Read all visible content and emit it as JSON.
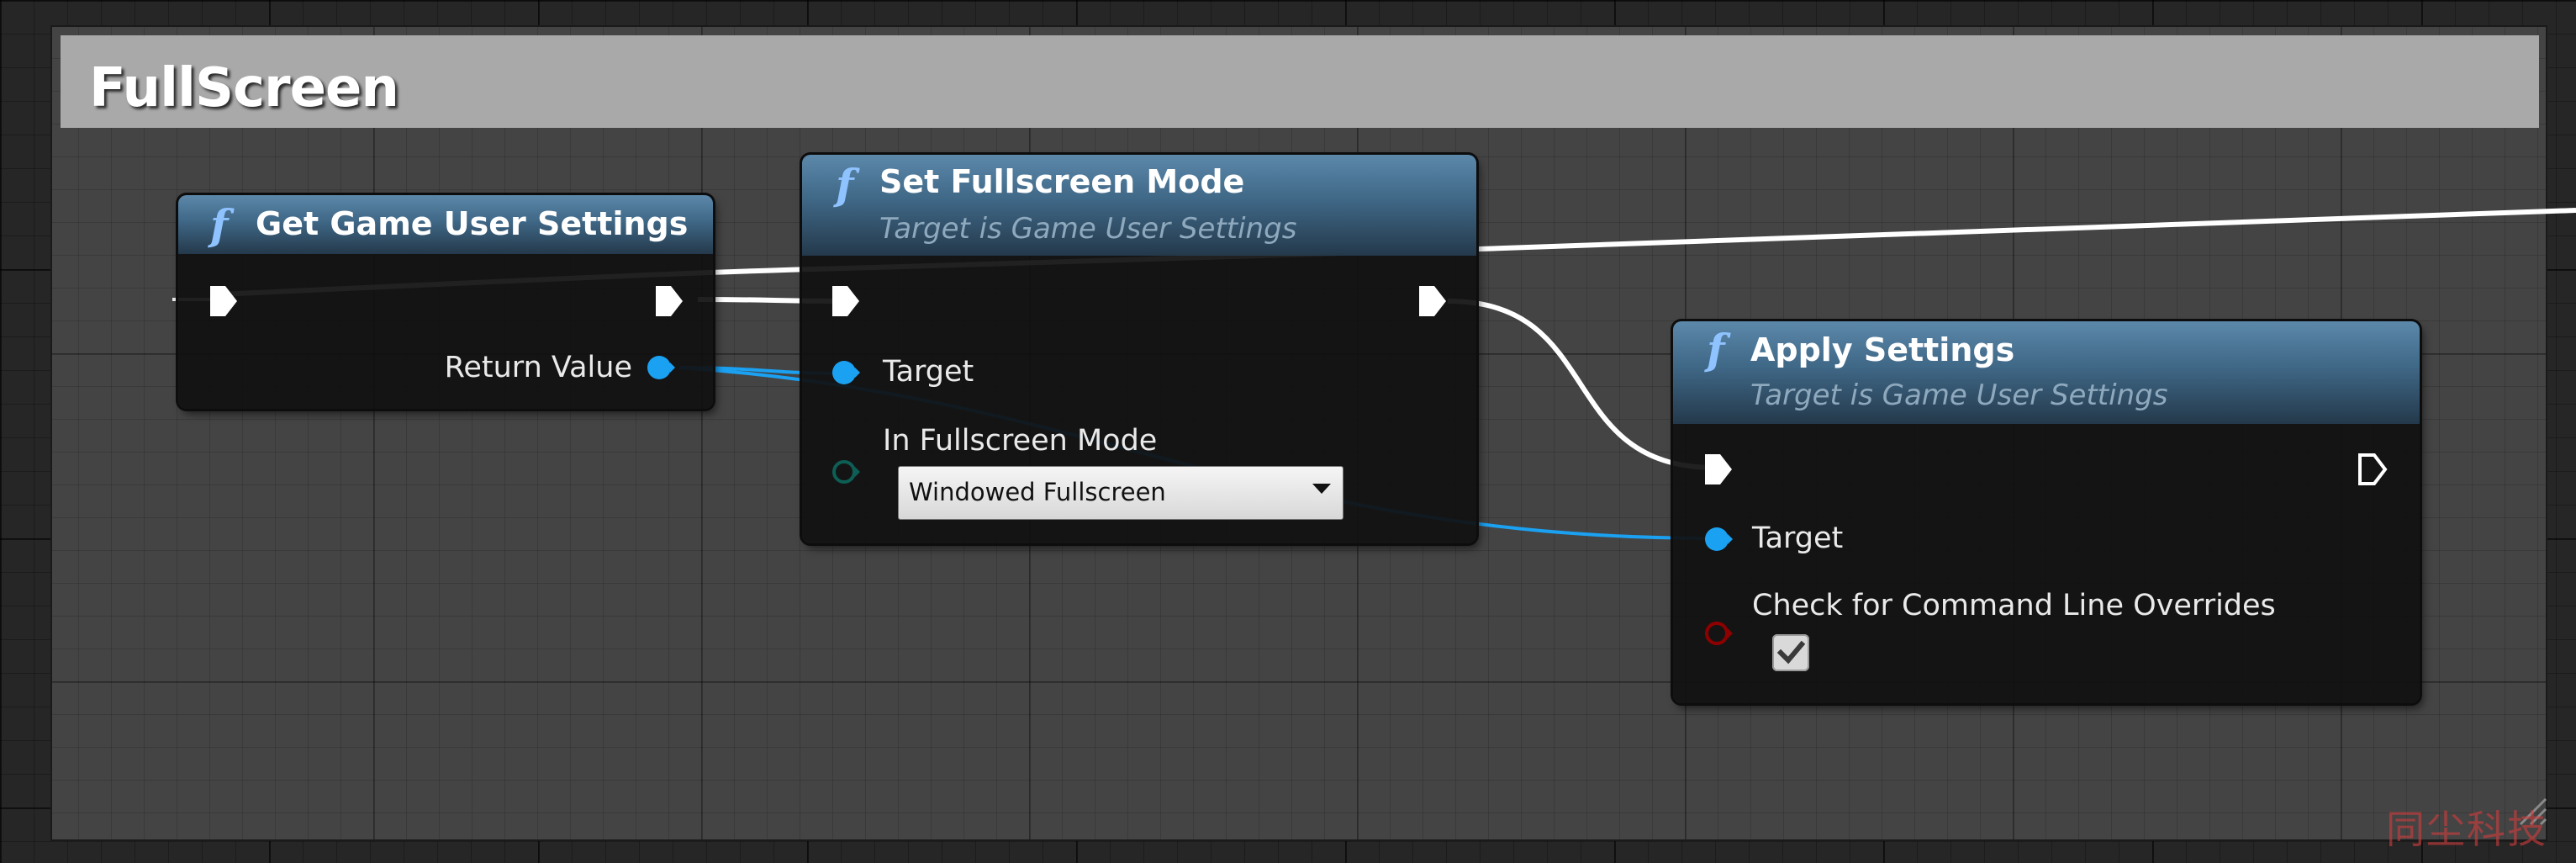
{
  "comment": {
    "title": "FullScreen"
  },
  "nodes": {
    "get_settings": {
      "icon": "function-icon",
      "title": "Get Game User Settings",
      "return_label": "Return Value"
    },
    "set_fullscreen": {
      "icon": "function-icon",
      "title": "Set Fullscreen Mode",
      "subtitle": "Target is Game User Settings",
      "target_label": "Target",
      "mode_label": "In Fullscreen Mode",
      "mode_value": "Windowed Fullscreen"
    },
    "apply_settings": {
      "icon": "function-icon",
      "title": "Apply Settings",
      "subtitle": "Target is Game User Settings",
      "target_label": "Target",
      "check_label": "Check for Command Line Overrides",
      "check_value": true
    }
  },
  "watermark": "同尘科技",
  "colors": {
    "object_pin": "#1ba1f2",
    "enum_pin": "#0d5e55",
    "bool_pin": "#8e0000",
    "exec_wire": "#ffffff",
    "header_blue": "#3f6786",
    "comment_header": "#a9a9a9"
  }
}
